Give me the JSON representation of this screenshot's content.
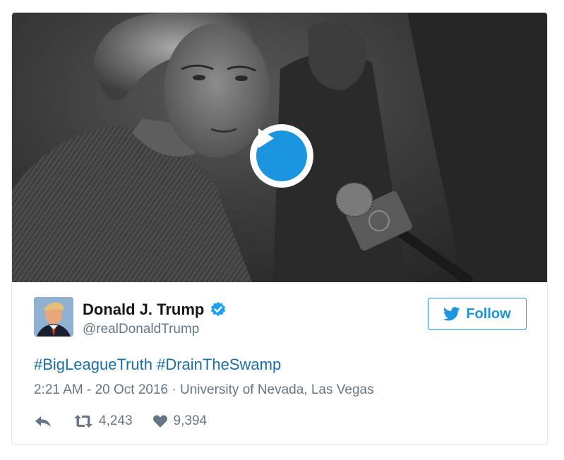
{
  "video": {
    "play_icon": "play-icon"
  },
  "author": {
    "name": "Donald J. Trump",
    "handle": "@realDonaldTrump",
    "verified_icon": "verified-badge-icon"
  },
  "follow_button": {
    "label": "Follow",
    "icon": "twitter-bird-icon"
  },
  "tweet": {
    "hashtags": [
      "#BigLeagueTruth",
      "#DrainTheSwamp"
    ],
    "time": "2:21 AM - 20 Oct 2016",
    "separator": "·",
    "location": "University of Nevada, Las Vegas"
  },
  "actions": {
    "reply_icon": "reply-icon",
    "retweet_icon": "retweet-icon",
    "retweet_count": "4,243",
    "like_icon": "heart-icon",
    "like_count": "9,394"
  },
  "colors": {
    "accent": "#1b95e0",
    "hashtag": "#1b6ea8",
    "secondary_text": "#657786"
  }
}
